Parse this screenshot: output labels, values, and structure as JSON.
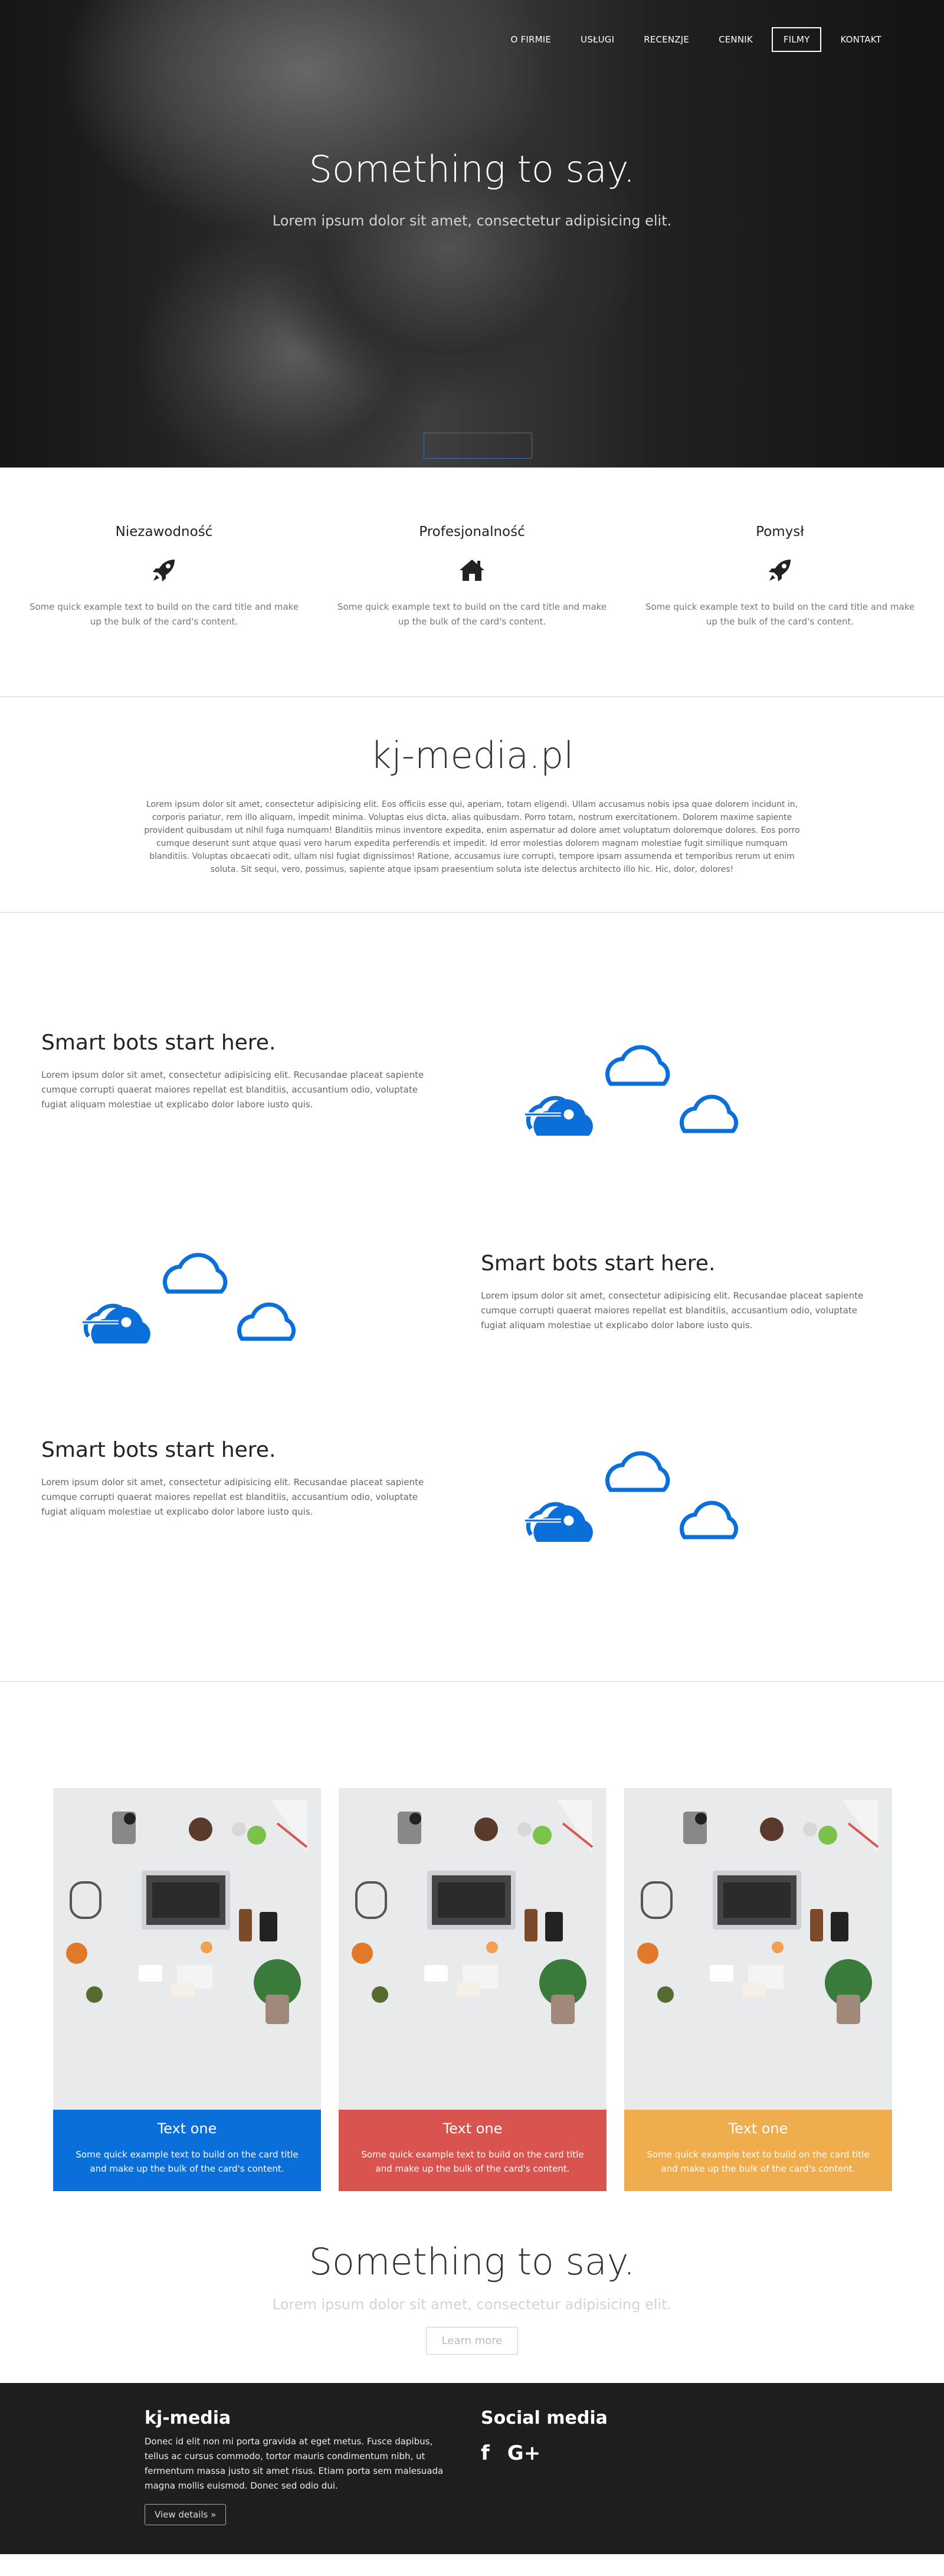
{
  "nav": {
    "items": [
      "O FIRMIE",
      "USŁUGI",
      "RECENZJE",
      "CENNIK",
      "FILMY",
      "KONTAKT"
    ],
    "active": "FILMY"
  },
  "hero": {
    "title": "Something to say.",
    "lead": "Lorem ipsum dolor sit amet, consectetur adipisicing elit."
  },
  "features": [
    {
      "title": "Niezawodność",
      "icon": "rocket-icon",
      "text": "Some quick example text to build on the card title and make up the bulk of the card's content."
    },
    {
      "title": "Profesjonalność",
      "icon": "home-icon",
      "text": "Some quick example text to build on the card title and make up the bulk of the card's content."
    },
    {
      "title": "Pomysł",
      "icon": "rocket-icon",
      "text": "Some quick example text to build on the card title and make up the bulk of the card's content."
    }
  ],
  "brand": {
    "title": "kj-media.pl",
    "text": "Lorem ipsum dolor sit amet, consectetur adipisicing elit. Eos officiis esse qui, aperiam, totam eligendi. Ullam accusamus nobis ipsa quae dolorem incidunt in, corporis pariatur, rem illo aliquam, impedit minima. Voluptas eius dicta, alias quibusdam. Porro totam, nostrum exercitationem. Dolorem maxime sapiente provident quibusdam ut nihil fuga numquam! Blanditiis minus inventore expedita, enim aspernatur ad dolore amet voluptatum doloremque dolores. Eos porro cumque deserunt sunt atque quasi vero harum expedita perferendis et impedit. Id error molestias dolorem magnam molestiae fugit similique numquam blanditiis. Voluptas obcaecati odit, ullam nisi fugiat dignissimos! Ratione, accusamus iure corrupti, tempore ipsam assumenda et temporibus rerum ut enim soluta. Sit sequi, vero, possimus, sapiente atque ipsam praesentium soluta iste delectus architecto illo hic. Hic, dolor, dolores!"
  },
  "featurettes": [
    {
      "title": "Smart bots start here.",
      "text": "Lorem ipsum dolor sit amet, consectetur adipisicing elit. Recusandae placeat sapiente cumque corrupti quaerat maiores repellat est blanditiis, accusantium odio, voluptate fugiat aliquam molestiae ut explicabo dolor labore iusto quis."
    },
    {
      "title": "Smart bots start here.",
      "text": "Lorem ipsum dolor sit amet, consectetur adipisicing elit. Recusandae placeat sapiente cumque corrupti quaerat maiores repellat est blanditiis, accusantium odio, voluptate fugiat aliquam molestiae ut explicabo dolor labore iusto quis."
    },
    {
      "title": "Smart bots start here.",
      "text": "Lorem ipsum dolor sit amet, consectetur adipisicing elit. Recusandae placeat sapiente cumque corrupti quaerat maiores repellat est blanditiis, accusantium odio, voluptate fugiat aliquam molestiae ut explicabo dolor labore iusto quis."
    }
  ],
  "cards": [
    {
      "title": "Text one",
      "text": "Some quick example text to build on the card title and make up the bulk of the card's content.",
      "color": "#0a6fd8"
    },
    {
      "title": "Text one",
      "text": "Some quick example text to build on the card title and make up the bulk of the card's content.",
      "color": "#d9534f"
    },
    {
      "title": "Text one",
      "text": "Some quick example text to build on the card title and make up the bulk of the card's content.",
      "color": "#f0ad4e"
    }
  ],
  "callout": {
    "title": "Something to say.",
    "lead": "Lorem ipsum dolor sit amet, consectetur adipisicing elit.",
    "button": "Learn more"
  },
  "footer": {
    "brand": "kj-media",
    "text": "Donec id elit non mi porta gravida at eget metus. Fusce dapibus, tellus ac cursus commodo, tortor mauris condimentum nibh, ut fermentum massa justo sit amet risus. Etiam porta sem malesuada magna mollis euismod. Donec sed odio dui.",
    "button": "View details »",
    "social_title": "Social media",
    "social": [
      {
        "icon": "facebook-icon",
        "label": "f"
      },
      {
        "icon": "google-plus-icon",
        "label": "G+"
      }
    ]
  },
  "colors": {
    "accent": "#0a6fd8",
    "footer_bg": "#1e1e1e"
  }
}
